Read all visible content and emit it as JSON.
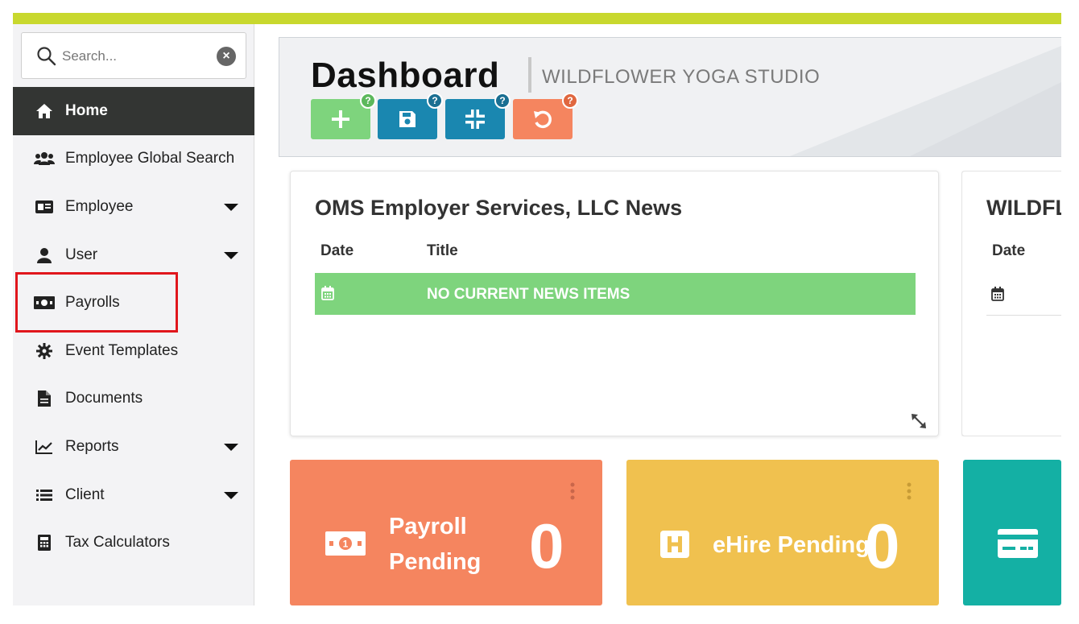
{
  "search": {
    "placeholder": "Search..."
  },
  "nav": [
    {
      "label": "Home",
      "icon": "home-icon",
      "active": true,
      "dropdown": false
    },
    {
      "label": "Employee Global Search",
      "icon": "users-icon",
      "dropdown": false
    },
    {
      "label": "Employee",
      "icon": "id-card-icon",
      "dropdown": true
    },
    {
      "label": "User",
      "icon": "user-icon",
      "dropdown": true
    },
    {
      "label": "Payrolls",
      "icon": "money-icon",
      "dropdown": false
    },
    {
      "label": "Event Templates",
      "icon": "gear-icon",
      "dropdown": false
    },
    {
      "label": "Documents",
      "icon": "document-icon",
      "dropdown": false
    },
    {
      "label": "Reports",
      "icon": "chart-icon",
      "dropdown": true
    },
    {
      "label": "Client",
      "icon": "list-icon",
      "dropdown": true
    },
    {
      "label": "Tax Calculators",
      "icon": "calculator-icon",
      "dropdown": false
    }
  ],
  "header": {
    "title": "Dashboard",
    "subtitle": "WILDFLOWER YOGA STUDIO",
    "help_mark": "?"
  },
  "news": {
    "title": "OMS Employer Services, LLC News",
    "col_date": "Date",
    "col_title": "Title",
    "empty_text": "NO CURRENT NEWS ITEMS"
  },
  "news2": {
    "title": "WILDFLOWER YOGA STUDIO News",
    "col_date": "Date"
  },
  "tiles": {
    "payroll": {
      "label_line1": "Payroll",
      "label_line2": "Pending",
      "count": "0"
    },
    "ehire": {
      "label": "eHire Pending",
      "count": "0"
    }
  },
  "colors": {
    "topbar": "#c8d82e",
    "green": "#7ed47d",
    "blue": "#1a87b0",
    "orange": "#f5855f",
    "yellow": "#f0c14f",
    "teal": "#14b0a4"
  }
}
